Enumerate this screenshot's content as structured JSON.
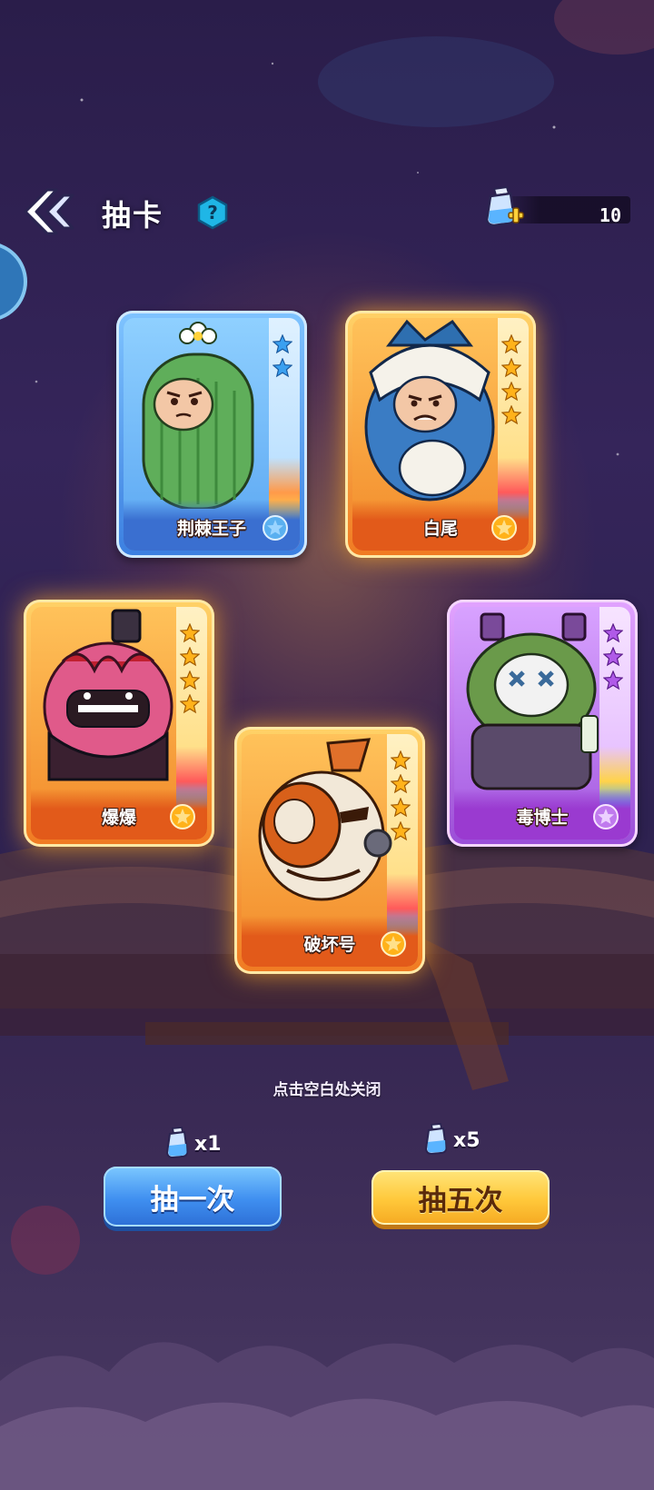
{
  "header": {
    "title": "抽卡",
    "help_glyph": "?",
    "currency_value": "10"
  },
  "cards": [
    {
      "name": "荆棘王子",
      "rarity": "blue",
      "stars": 2,
      "color": "#3b7fe0"
    },
    {
      "name": "白尾",
      "rarity": "orange",
      "stars": 4,
      "color": "#f07a22"
    },
    {
      "name": "爆爆",
      "rarity": "orange",
      "stars": 4,
      "color": "#f07a22"
    },
    {
      "name": "毒博士",
      "rarity": "purple",
      "stars": 3,
      "color": "#9a4ed8"
    },
    {
      "name": "破坏号",
      "rarity": "orange",
      "stars": 4,
      "color": "#f07a22"
    }
  ],
  "hint": "点击空白处关闭",
  "draw": {
    "single": {
      "cost": "x1",
      "label": "抽一次"
    },
    "five": {
      "cost": "x5",
      "label": "抽五次"
    }
  },
  "icons": {
    "back": "double-chevron-left-icon",
    "help": "question-hexagon-icon",
    "currency": "potion-bottle-plus-icon",
    "emblem": "flower-emblem-icon"
  }
}
